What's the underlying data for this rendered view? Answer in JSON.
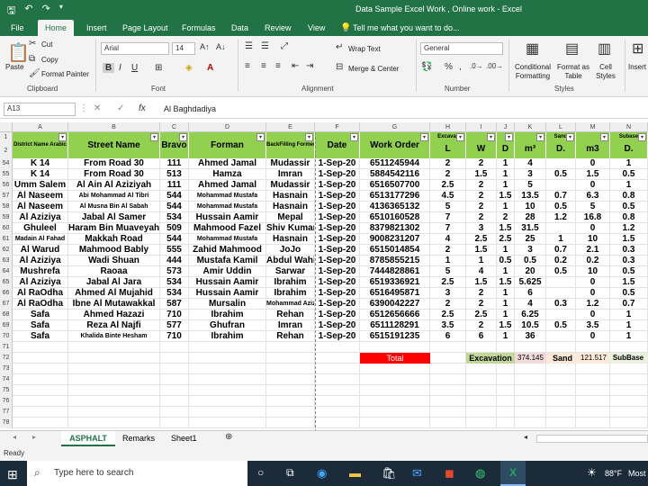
{
  "window": {
    "title": "Data Sample Excel Work , Online work - Excel"
  },
  "ribbon_tabs": [
    "File",
    "Home",
    "Insert",
    "Page Layout",
    "Formulas",
    "Data",
    "Review",
    "View"
  ],
  "tell_me": "Tell me what you want to do...",
  "clipboard": {
    "paste": "Paste",
    "cut": "Cut",
    "copy": "Copy",
    "format_painter": "Format Painter",
    "label": "Clipboard"
  },
  "font": {
    "name": "Arial",
    "size": "14",
    "label": "Font"
  },
  "alignment": {
    "wrap": "Wrap Text",
    "merge": "Merge & Center",
    "label": "Alignment"
  },
  "number": {
    "format": "General",
    "label": "Number"
  },
  "styles": {
    "conditional": "Conditional Formatting",
    "format_as": "Format as Table",
    "cell_styles": "Cell Styles",
    "label": "Styles"
  },
  "insert_btn": "Insert",
  "formula": {
    "name_box": "A13",
    "content": "Al Baghdadiya"
  },
  "columns": [
    "A",
    "B",
    "C",
    "D",
    "E",
    "F",
    "G",
    "H",
    "I",
    "J",
    "K",
    "L",
    "M",
    "N"
  ],
  "headers": {
    "a": "District Name Arabic",
    "b": "Street Name",
    "c": "Bravo",
    "d": "Forman",
    "e": "BackFilling Formen",
    "f": "Date",
    "g": "Work Order",
    "h": "Excavat",
    "h2": "L",
    "i": "W",
    "j": "D",
    "k": "m³",
    "l": "Sand",
    "l2": "D.",
    "m": "m3",
    "n": "Subase",
    "n2": "D."
  },
  "rows": [
    {
      "n": "54",
      "a": "K 14",
      "b": "From Road 30",
      "c": "111",
      "d": "Ahmed Jamal",
      "e": "Mudassir",
      "f": "1-Sep-20",
      "g": "6511245944",
      "h": "2",
      "i": "2",
      "j": "1",
      "k": "4",
      "l": "",
      "m": "0",
      "n2": "1"
    },
    {
      "n": "55",
      "a": "K 14",
      "b": "From Road 30",
      "c": "513",
      "d": "Hamza",
      "e": "Imran",
      "f": "1-Sep-20",
      "g": "5884542116",
      "h": "2",
      "i": "1.5",
      "j": "1",
      "k": "3",
      "l": "0.5",
      "m": "1.5",
      "n2": "0.5"
    },
    {
      "n": "56",
      "a": "Umm Salem",
      "b": "Al Ain Al Aziziyah",
      "c": "111",
      "d": "Ahmed Jamal",
      "e": "Mudassir",
      "f": "1-Sep-20",
      "g": "6516507700",
      "h": "2.5",
      "i": "2",
      "j": "1",
      "k": "5",
      "l": "",
      "m": "0",
      "n2": "1"
    },
    {
      "n": "57",
      "a": "Al Naseem",
      "b": "Abi Mohammad Al Tibri",
      "c": "544",
      "d": "Mohammad Mustafa",
      "e": "Hasnain",
      "f": "1-Sep-20",
      "g": "6513177296",
      "h": "4.5",
      "i": "2",
      "j": "1.5",
      "k": "13.5",
      "l": "0.7",
      "m": "6.3",
      "n2": "0.8"
    },
    {
      "n": "58",
      "a": "Al Naseem",
      "b": "Al Musna Bin Al Sabah",
      "c": "544",
      "d": "Mohammad Mustafa",
      "e": "Hasnain",
      "f": "1-Sep-20",
      "g": "4136365132",
      "h": "5",
      "i": "2",
      "j": "1",
      "k": "10",
      "l": "0.5",
      "m": "5",
      "n2": "0.5"
    },
    {
      "n": "59",
      "a": "Al Aziziya",
      "b": "Jabal Al Samer",
      "c": "534",
      "d": "Hussain Aamir",
      "e": "Mepal",
      "f": "1-Sep-20",
      "g": "6510160528",
      "h": "7",
      "i": "2",
      "j": "2",
      "k": "28",
      "l": "1.2",
      "m": "16.8",
      "n2": "0.8"
    },
    {
      "n": "60",
      "a": "Ghuleel",
      "b": "Haram Bin Muaveyah",
      "c": "509",
      "d": "Mahmood Fazel",
      "e": "Shiv Kumar",
      "f": "1-Sep-20",
      "g": "8379821302",
      "h": "7",
      "i": "3",
      "j": "1.5",
      "k": "31.5",
      "l": "",
      "m": "0",
      "n2": "1.2"
    },
    {
      "n": "61",
      "a": "Madain Al Fahad",
      "b": "Makkah Road",
      "c": "544",
      "d": "Mohammad Mustafa",
      "e": "Hasnain",
      "f": "1-Sep-20",
      "g": "9008231207",
      "h": "4",
      "i": "2.5",
      "j": "2.5",
      "k": "25",
      "l": "1",
      "m": "10",
      "n2": "1.5"
    },
    {
      "n": "62",
      "a": "Al Warud",
      "b": "Mahmood Bably",
      "c": "555",
      "d": "Zahid Mahmood",
      "e": "JoJo",
      "f": "1-Sep-20",
      "g": "6515014854",
      "h": "2",
      "i": "1.5",
      "j": "1",
      "k": "3",
      "l": "0.7",
      "m": "2.1",
      "n2": "0.3"
    },
    {
      "n": "63",
      "a": "Al Aziziya",
      "b": "Wadi Shuan",
      "c": "444",
      "d": "Mustafa Kamil",
      "e": "Abdul Wahid",
      "f": "1-Sep-20",
      "g": "8785855215",
      "h": "1",
      "i": "1",
      "j": "0.5",
      "k": "0.5",
      "l": "0.2",
      "m": "0.2",
      "n2": "0.3"
    },
    {
      "n": "64",
      "a": "Mushrefa",
      "b": "Raoaa",
      "c": "573",
      "d": "Amir Uddin",
      "e": "Sarwar",
      "f": "1-Sep-20",
      "g": "7444828861",
      "h": "5",
      "i": "4",
      "j": "1",
      "k": "20",
      "l": "0.5",
      "m": "10",
      "n2": "0.5"
    },
    {
      "n": "65",
      "a": "Al Aziziya",
      "b": "Jabal Al Jara",
      "c": "534",
      "d": "Hussain Aamir",
      "e": "Ibrahim",
      "f": "1-Sep-20",
      "g": "6519336921",
      "h": "2.5",
      "i": "1.5",
      "j": "1.5",
      "k": "5.625",
      "l": "",
      "m": "0",
      "n2": "1.5"
    },
    {
      "n": "66",
      "a": "Al RaOdha",
      "b": "Ahmed Al Mujahid",
      "c": "534",
      "d": "Hussain Aamir",
      "e": "Ibrahim",
      "f": "1-Sep-20",
      "g": "6516495871",
      "h": "3",
      "i": "2",
      "j": "1",
      "k": "6",
      "l": "",
      "m": "0",
      "n2": "0.5"
    },
    {
      "n": "67",
      "a": "Al RaOdha",
      "b": "Ibne Al Mutawakkal",
      "c": "587",
      "d": "Mursalin",
      "e": "Mohammad Aziz",
      "f": "1-Sep-20",
      "g": "6390042227",
      "h": "2",
      "i": "2",
      "j": "1",
      "k": "4",
      "l": "0.3",
      "m": "1.2",
      "n2": "0.7"
    },
    {
      "n": "68",
      "a": "Safa",
      "b": "Ahmed Hazazi",
      "c": "710",
      "d": "Ibrahim",
      "e": "Rehan",
      "f": "1-Sep-20",
      "g": "6512656666",
      "h": "2.5",
      "i": "2.5",
      "j": "1",
      "k": "6.25",
      "l": "",
      "m": "0",
      "n2": "1"
    },
    {
      "n": "69",
      "a": "Safa",
      "b": "Reza Al Najfi",
      "c": "577",
      "d": "Ghufran",
      "e": "Imran",
      "f": "1-Sep-20",
      "g": "6511128291",
      "h": "3.5",
      "i": "2",
      "j": "1.5",
      "k": "10.5",
      "l": "0.5",
      "m": "3.5",
      "n2": "1"
    },
    {
      "n": "70",
      "a": "Safa",
      "b": "Khalida Binte Hesham",
      "c": "710",
      "d": "Ibrahim",
      "e": "Rehan",
      "f": "1-Sep-20",
      "g": "6515191235",
      "h": "6",
      "i": "6",
      "j": "1",
      "k": "36",
      "l": "",
      "m": "0",
      "n2": "1"
    }
  ],
  "empty_rows": [
    "71",
    "72",
    "73",
    "74",
    "75",
    "76",
    "77",
    "78"
  ],
  "totals": {
    "total": "Total",
    "excavation": "Excavation",
    "exc_val": "374.145",
    "sand": "Sand",
    "sand_val": "121.517",
    "subbase": "SubBase"
  },
  "sheets": [
    "ASPHALT",
    "Remarks",
    "Sheet1"
  ],
  "status": "Ready",
  "taskbar": {
    "search": "Type here to search",
    "weather": "88°F",
    "weather_more": "Most"
  },
  "colors": {
    "excel_green": "#217346",
    "header_green": "#92d050",
    "total_red": "#ff0000",
    "exc_green": "#c4d79b"
  }
}
